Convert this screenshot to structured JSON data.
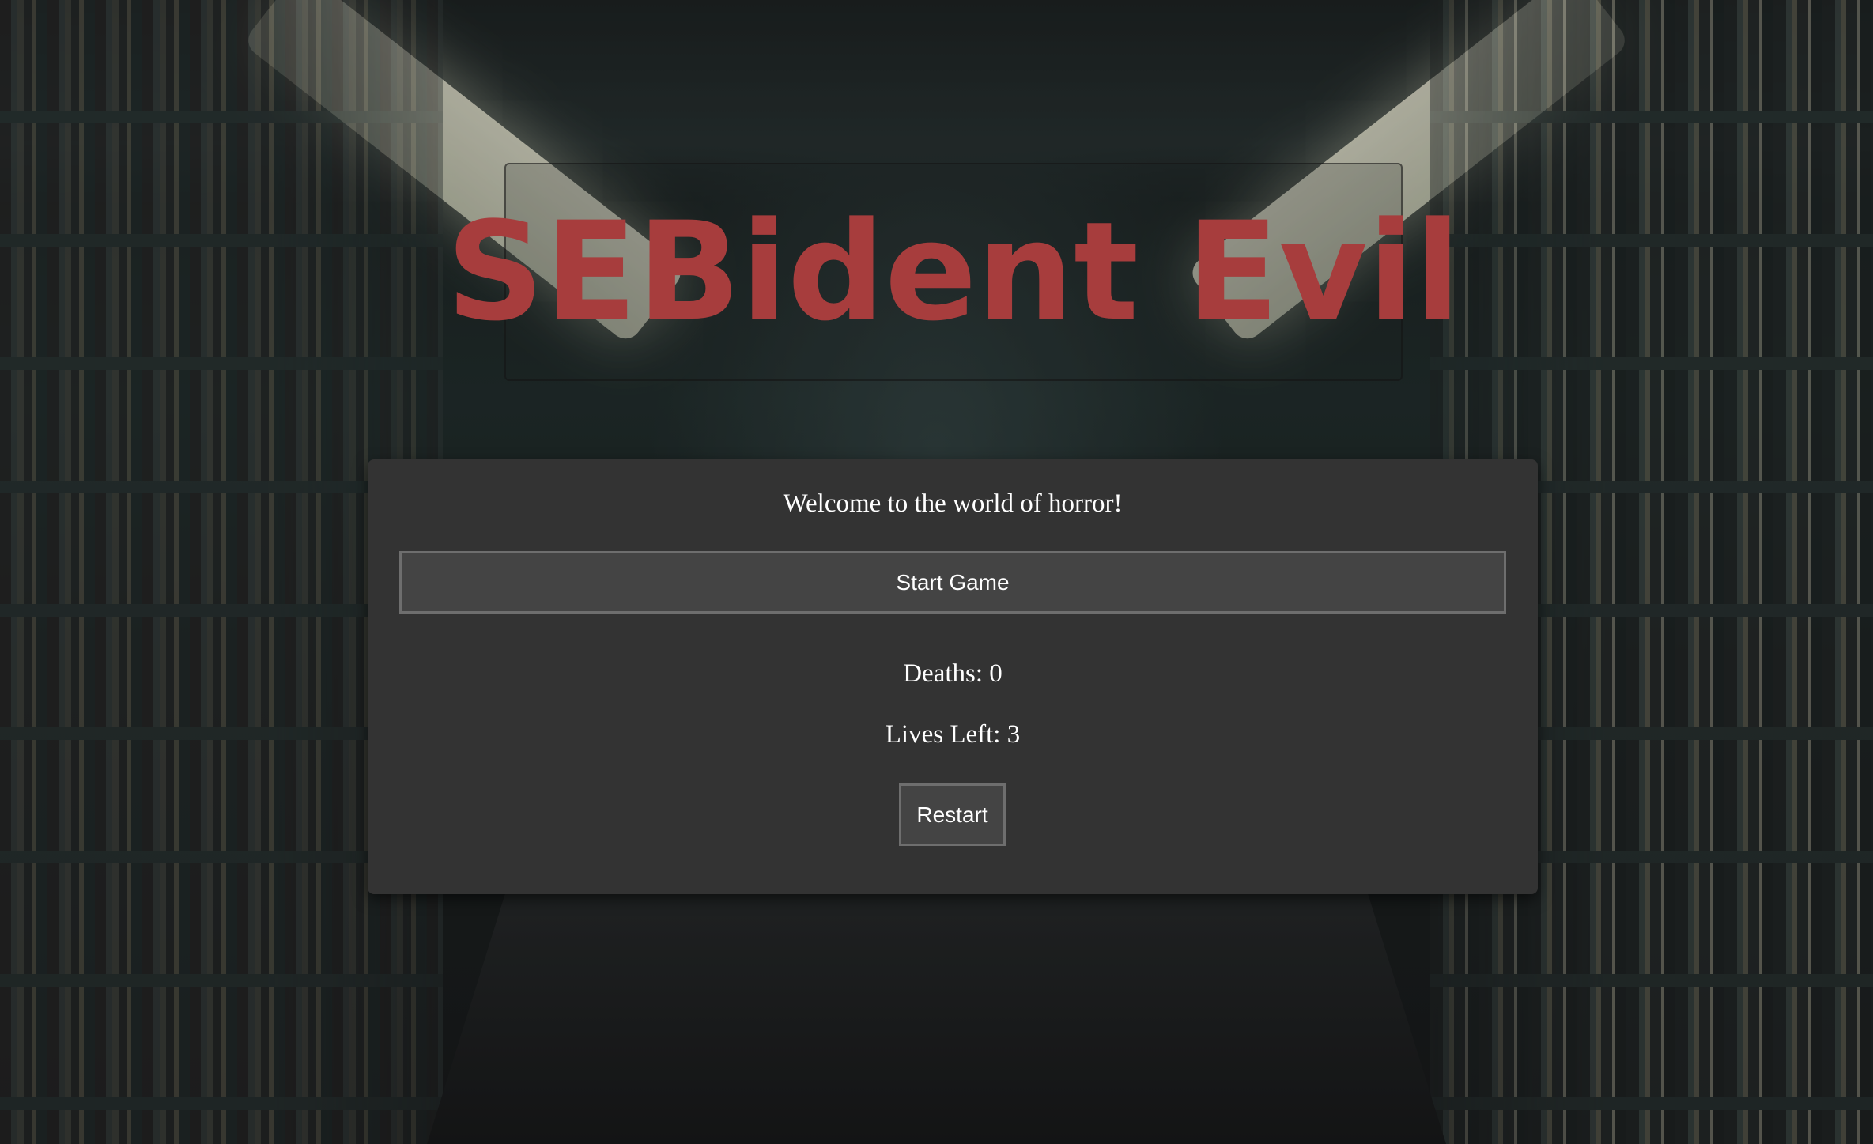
{
  "title": "SEBident Evil",
  "panel": {
    "welcome": "Welcome to the world of horror!",
    "start_label": "Start Game",
    "deaths_label": "Deaths:",
    "deaths_value": "0",
    "lives_label": "Lives Left:",
    "lives_value": "3",
    "restart_label": "Restart"
  },
  "colors": {
    "title": "#a73d3d",
    "panel_bg": "#333333",
    "button_bg": "#444444",
    "button_border": "#6e6e6e",
    "text": "#ffffff"
  }
}
